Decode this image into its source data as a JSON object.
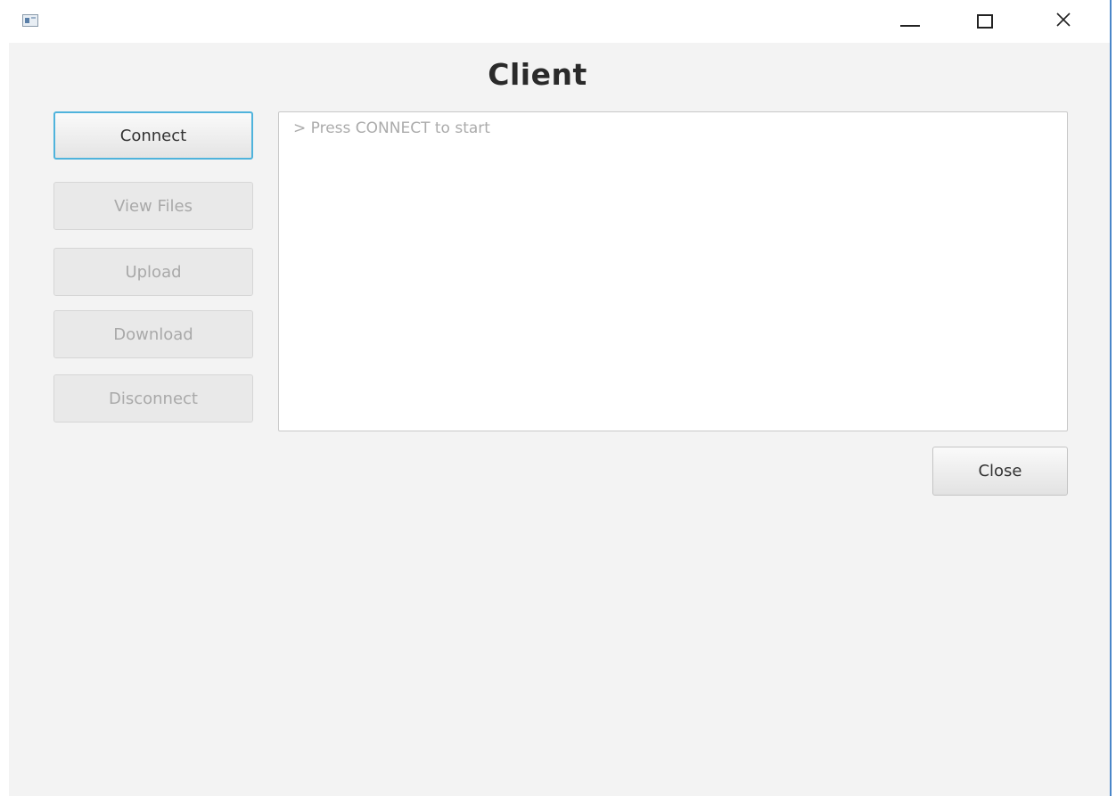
{
  "window": {
    "title_text": "",
    "controls": {
      "minimize": "minimize-icon",
      "maximize": "maximize-icon",
      "close": "close-icon"
    }
  },
  "main": {
    "heading": "Client",
    "buttons": {
      "connect": "Connect",
      "view_files": "View Files",
      "upload": "Upload",
      "download": "Download",
      "disconnect": "Disconnect"
    },
    "console_text": "> Press CONNECT to start",
    "close_button": "Close"
  },
  "colors": {
    "focus_border": "#4fb3dc",
    "background": "#f3f3f3",
    "disabled_text": "#a9a9a9"
  }
}
